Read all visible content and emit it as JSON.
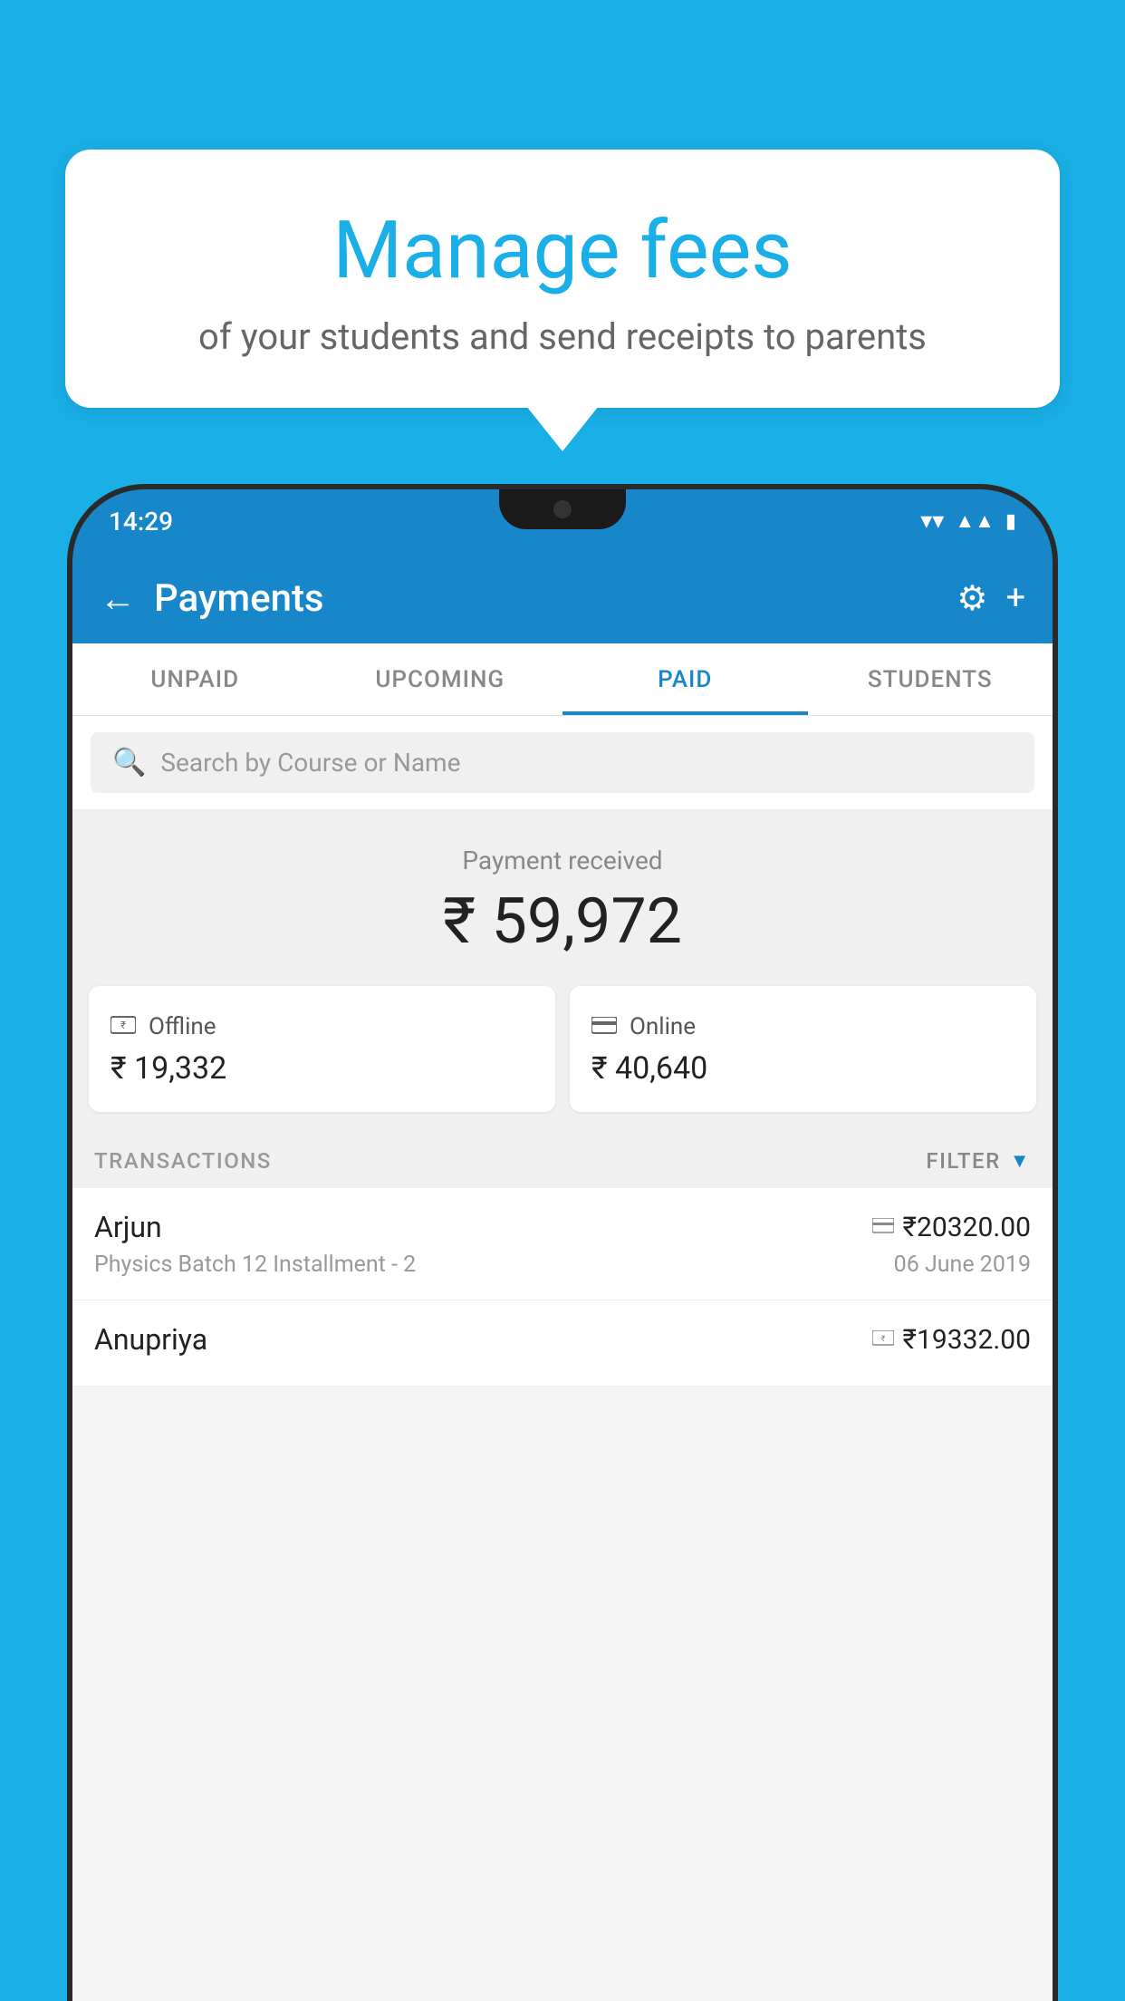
{
  "background_color": "#1AAFE6",
  "bubble": {
    "title": "Manage fees",
    "subtitle": "of your students and send receipts to parents"
  },
  "status_bar": {
    "time": "14:29",
    "wifi_icon": "▾",
    "signal_icon": "▲",
    "battery_icon": "▮"
  },
  "app_bar": {
    "title": "Payments",
    "back_icon": "←",
    "gear_icon": "⚙",
    "plus_icon": "+"
  },
  "tabs": [
    {
      "label": "UNPAID",
      "active": false
    },
    {
      "label": "UPCOMING",
      "active": false
    },
    {
      "label": "PAID",
      "active": true
    },
    {
      "label": "STUDENTS",
      "active": false
    }
  ],
  "search": {
    "placeholder": "Search by Course or Name"
  },
  "payment_received": {
    "label": "Payment received",
    "amount": "₹ 59,972"
  },
  "payment_cards": [
    {
      "mode": "Offline",
      "amount": "₹ 19,332",
      "icon": "rupee-card"
    },
    {
      "mode": "Online",
      "amount": "₹ 40,640",
      "icon": "credit-card"
    }
  ],
  "transactions_label": "TRANSACTIONS",
  "filter_label": "FILTER",
  "transactions": [
    {
      "name": "Arjun",
      "description": "Physics Batch 12 Installment - 2",
      "amount": "₹20320.00",
      "date": "06 June 2019",
      "mode_icon": "card"
    },
    {
      "name": "Anupriya",
      "description": "",
      "amount": "₹19332.00",
      "date": "",
      "mode_icon": "rupee"
    }
  ]
}
